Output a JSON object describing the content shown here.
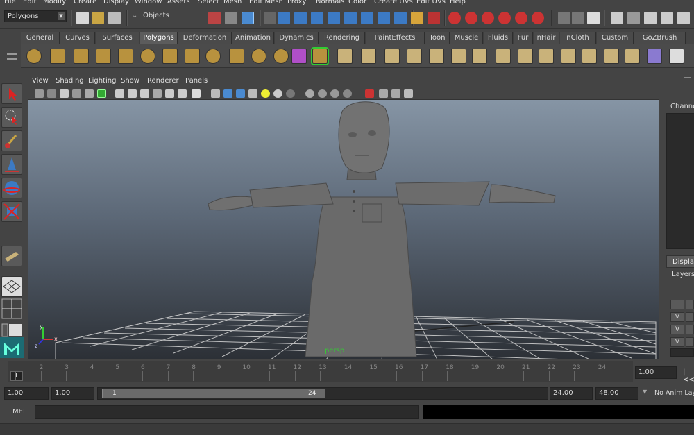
{
  "menu": [
    "File",
    "Edit",
    "Modify",
    "Create",
    "Display",
    "Window",
    "Assets",
    "Select",
    "Mesh",
    "Edit Mesh",
    "Proxy",
    "Normals",
    "Color",
    "Create UVs",
    "Edit UVs",
    "Help"
  ],
  "status_line": {
    "menu_set": "Polygons",
    "selection_mode": "Objects"
  },
  "shelf_tabs": [
    "General",
    "Curves",
    "Surfaces",
    "Polygons",
    "Deformation",
    "Animation",
    "Dynamics",
    "Rendering",
    "PaintEffects",
    "Toon",
    "Muscle",
    "Fluids",
    "Fur",
    "nHair",
    "nCloth",
    "Custom",
    "GoZBrush"
  ],
  "active_shelf_tab": "Polygons",
  "viewport": {
    "menu": [
      "View",
      "Shading",
      "Lighting",
      "Show",
      "Renderer",
      "Panels"
    ],
    "camera_label": "persp",
    "axis_labels": {
      "x": "x",
      "y": "y",
      "z": "z"
    }
  },
  "right_panel": {
    "channel_label": "Channe",
    "display_tab": "Display",
    "layers_label": "Layers",
    "layer_rows": [
      "V",
      "V",
      "V"
    ]
  },
  "time_slider": {
    "ticks": [
      "1",
      "2",
      "3",
      "4",
      "5",
      "6",
      "7",
      "8",
      "9",
      "10",
      "11",
      "12",
      "13",
      "14",
      "15",
      "16",
      "17",
      "18",
      "19",
      "20",
      "21",
      "22",
      "23",
      "24"
    ],
    "current_frame": "1",
    "current_time_field": "1.00",
    "goto_start": "|<<"
  },
  "range_slider": {
    "start_time": "1.00",
    "playback_start": "1.00",
    "range_start_label": "1",
    "range_end_label": "24",
    "playback_end": "24.00",
    "end_time": "48.00",
    "anim_layer": "No Anim Layer"
  },
  "command_line": {
    "label": "MEL"
  }
}
